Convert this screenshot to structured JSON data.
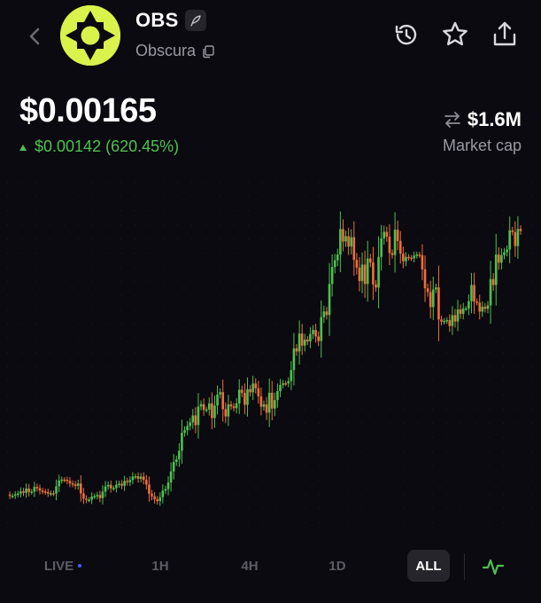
{
  "token": {
    "ticker": "OBS",
    "name": "Obscura"
  },
  "price": {
    "value": "$0.00165",
    "change": "$0.00142 (620.45%)"
  },
  "market_cap": {
    "value": "$1.6M",
    "label": "Market cap"
  },
  "icons": {
    "back": "chevron-left-icon",
    "edit": "feather-icon",
    "copy": "copy-icon",
    "history": "history-icon",
    "favorite": "star-icon",
    "share": "share-icon",
    "swap": "swap-arrows-icon",
    "chart_type": "line-chart-icon"
  },
  "timeframes": [
    {
      "label": "LIVE",
      "active": false
    },
    {
      "label": "1H",
      "active": false
    },
    {
      "label": "4H",
      "active": false
    },
    {
      "label": "1D",
      "active": false
    },
    {
      "label": "ALL",
      "active": true
    }
  ],
  "colors": {
    "background": "#0b0a10",
    "up": "#4ec150",
    "down": "#f26d3d",
    "logo": "#d9f24c",
    "muted": "#9a9aa4",
    "live_dot": "#4a5cff"
  },
  "chart_data": {
    "type": "candlestick",
    "unit": "relative price",
    "values": [
      1.0,
      0.993,
      0.994,
      1.001,
      1.005,
      1.017,
      1.009,
      1.031,
      1.013,
      1.015,
      1.039,
      1.032,
      1.02,
      1.016,
      1.013,
      1.005,
      1.007,
      1.005,
      1.042,
      1.071,
      1.076,
      1.075,
      1.069,
      1.057,
      1.052,
      1.044,
      1.056,
      1.006,
      0.98,
      0.973,
      0.974,
      0.99,
      0.992,
      0.998,
      0.982,
      1.015,
      1.041,
      1.049,
      1.032,
      1.033,
      1.05,
      1.055,
      1.045,
      1.069,
      1.062,
      1.074,
      1.091,
      1.093,
      1.08,
      1.091,
      1.074,
      1.051,
      1.004,
      0.991,
      0.976,
      0.967,
      0.987,
      1.02,
      1.028,
      1.061,
      1.117,
      1.165,
      1.178,
      1.222,
      1.313,
      1.326,
      1.348,
      1.366,
      1.401,
      1.352,
      1.446,
      1.458,
      1.429,
      1.431,
      1.462,
      1.388,
      1.451,
      1.507,
      1.519,
      1.433,
      1.396,
      1.457,
      1.447,
      1.438,
      1.462,
      1.531,
      1.515,
      1.455,
      1.534,
      1.518,
      1.563,
      1.539,
      1.498,
      1.445,
      1.457,
      1.415,
      1.516,
      1.436,
      1.479,
      1.524,
      1.555,
      1.564,
      1.563,
      1.575,
      1.631,
      1.741,
      1.725,
      1.816,
      1.755,
      1.785,
      1.776,
      1.813,
      1.834,
      1.801,
      1.778,
      1.899,
      1.928,
      1.91,
      2.067,
      2.153,
      2.187,
      2.216,
      2.345,
      2.282,
      2.309,
      2.257,
      2.304,
      2.189,
      2.15,
      2.082,
      2.165,
      2.067,
      2.196,
      2.176,
      2.065,
      2.049,
      2.204,
      2.298,
      2.331,
      2.307,
      2.224,
      2.214,
      2.342,
      2.285,
      2.221,
      2.182,
      2.204,
      2.2,
      2.197,
      2.211,
      2.216,
      2.213,
      2.141,
      2.045,
      2.026,
      1.95,
      2.039,
      2.05,
      1.887,
      1.876,
      1.88,
      1.884,
      1.854,
      1.909,
      1.877,
      1.938,
      1.916,
      1.943,
      1.943,
      1.98,
      2.062,
      1.978,
      1.973,
      1.927,
      1.952,
      1.941,
      1.958,
      2.092,
      2.062,
      2.216,
      2.175,
      2.213,
      2.228,
      2.242,
      2.339,
      2.33,
      2.259,
      2.346,
      2.335
    ]
  }
}
